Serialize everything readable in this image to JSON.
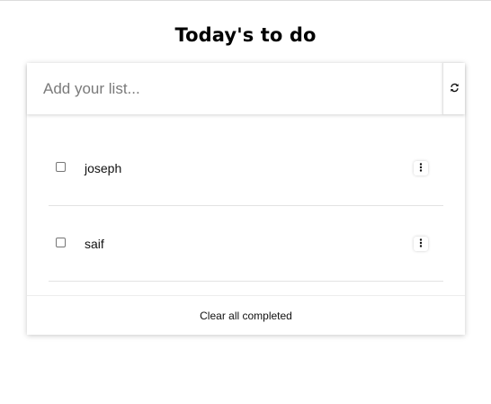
{
  "header": {
    "title": "Today's to do"
  },
  "input": {
    "placeholder": "Add your list...",
    "value": ""
  },
  "refresh_button": {
    "icon": "refresh-icon"
  },
  "todos": [
    {
      "label": "joseph",
      "checked": false,
      "menu_icon": "more-vertical-icon"
    },
    {
      "label": "saif",
      "checked": false,
      "menu_icon": "more-vertical-icon"
    }
  ],
  "footer": {
    "clear_label": "Clear all completed"
  }
}
